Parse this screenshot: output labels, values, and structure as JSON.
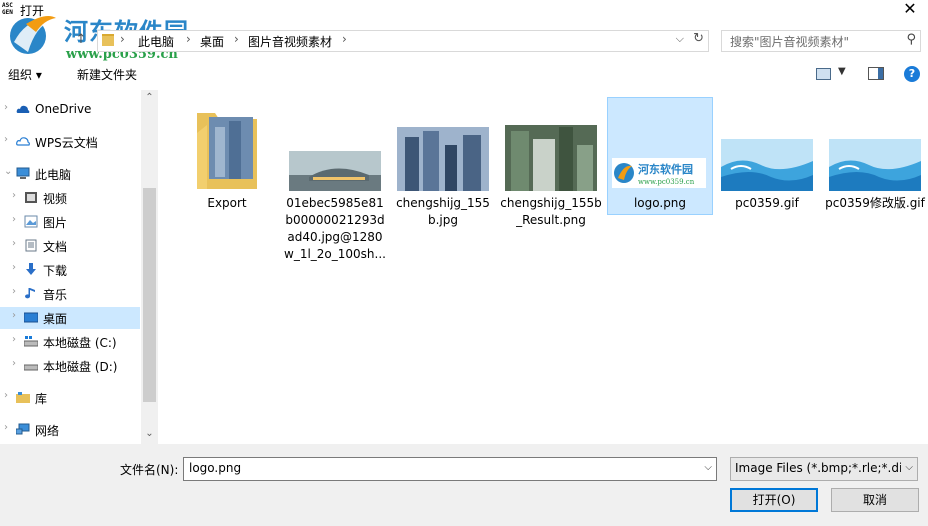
{
  "window": {
    "title": "打开",
    "app_icon_text": "ASCGEN"
  },
  "watermark": {
    "name": "河东软件园",
    "url": "www.pc0359.cn"
  },
  "nav": {
    "breadcrumbs": [
      "此电脑",
      "桌面",
      "图片音视频素材"
    ],
    "search_placeholder": "搜索\"图片音视频素材\""
  },
  "toolbar": {
    "organize": "组织 ▾",
    "new_folder": "新建文件夹",
    "help": "?"
  },
  "sidebar": {
    "items": [
      {
        "label": "OneDrive",
        "icon": "cloud-icon",
        "selected": false
      },
      {
        "label": "WPS云文档",
        "icon": "cloud-outline-icon",
        "selected": false
      },
      {
        "label": "此电脑",
        "icon": "computer-icon",
        "selected": false
      },
      {
        "label": "视频",
        "icon": "video-folder-icon",
        "selected": false
      },
      {
        "label": "图片",
        "icon": "pictures-folder-icon",
        "selected": false
      },
      {
        "label": "文档",
        "icon": "documents-folder-icon",
        "selected": false
      },
      {
        "label": "下载",
        "icon": "download-icon",
        "selected": false
      },
      {
        "label": "音乐",
        "icon": "music-icon",
        "selected": false
      },
      {
        "label": "桌面",
        "icon": "desktop-icon",
        "selected": true
      },
      {
        "label": "本地磁盘 (C:)",
        "icon": "drive-c-icon",
        "selected": false
      },
      {
        "label": "本地磁盘 (D:)",
        "icon": "drive-icon",
        "selected": false
      },
      {
        "label": "库",
        "icon": "library-icon",
        "selected": false
      },
      {
        "label": "网络",
        "icon": "network-icon",
        "selected": false
      }
    ]
  },
  "files": [
    {
      "name": "Export",
      "kind": "folder"
    },
    {
      "name": "01ebec5985e81b00000021293dad40.jpg@1280w_1l_2o_100sh...",
      "kind": "image"
    },
    {
      "name": "chengshijg_155b.jpg",
      "kind": "image"
    },
    {
      "name": "chengshijg_155b_Result.png",
      "kind": "image"
    },
    {
      "name": "logo.png",
      "kind": "image",
      "selected": true
    },
    {
      "name": "pc0359.gif",
      "kind": "image"
    },
    {
      "name": "pc0359修改版.gif",
      "kind": "image"
    }
  ],
  "footer": {
    "filename_label": "文件名(N):",
    "filename_value": "logo.png",
    "filetype_value": "Image Files (*.bmp;*.rle;*.dib",
    "open_label": "打开(O)",
    "cancel_label": "取消"
  },
  "colors": {
    "selection": "#cce8ff",
    "accent": "#0078d7",
    "folder": "#e8c15a"
  }
}
